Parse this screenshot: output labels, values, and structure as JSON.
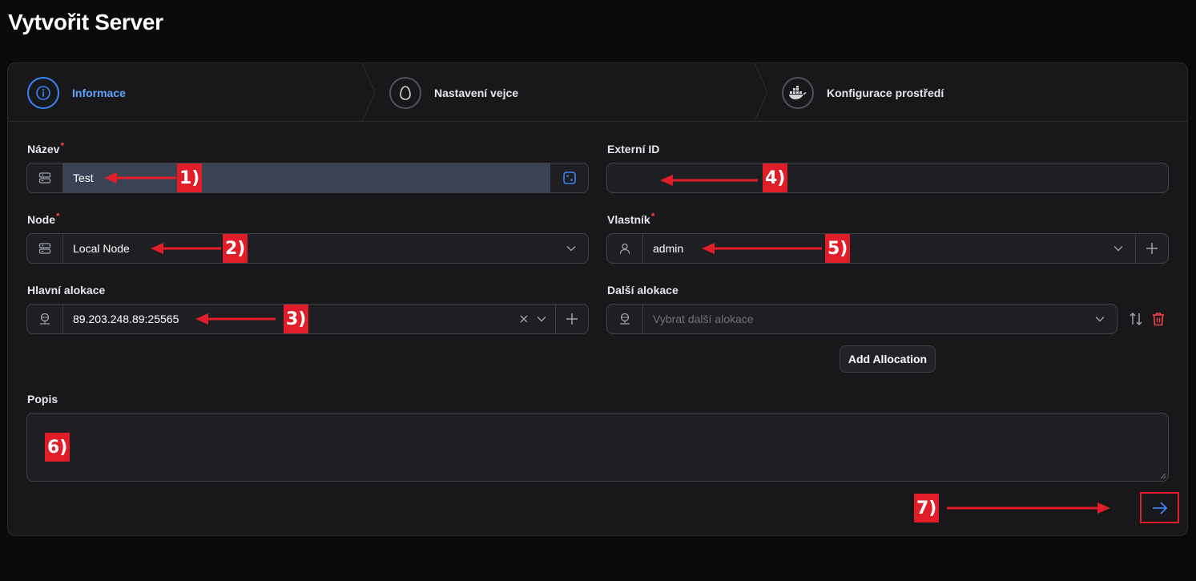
{
  "page": {
    "title": "Vytvořit Server"
  },
  "stepper": {
    "steps": [
      {
        "label": "Informace",
        "icon": "info-icon",
        "active": true
      },
      {
        "label": "Nastavení vejce",
        "icon": "egg-icon",
        "active": false
      },
      {
        "label": "Konfigurace prostředí",
        "icon": "docker-icon",
        "active": false
      }
    ]
  },
  "form": {
    "name": {
      "label": "Název",
      "required": "*",
      "value": "Test",
      "icon": "server-icon",
      "action_icon": "dice-icon"
    },
    "external_id": {
      "label": "Externí ID",
      "value": ""
    },
    "node": {
      "label": "Node",
      "required": "*",
      "value": "Local Node",
      "icon": "server-icon"
    },
    "owner": {
      "label": "Vlastník",
      "required": "*",
      "value": "admin",
      "icon": "user-icon"
    },
    "primary_allocation": {
      "label": "Hlavní alokace",
      "value": "89.203.248.89:25565",
      "icon": "network-icon"
    },
    "additional_allocations": {
      "label": "Další alokace",
      "placeholder": "Vybrat další alokace",
      "icon": "network-icon",
      "add_button": "Add Allocation"
    },
    "description": {
      "label": "Popis",
      "value": ""
    }
  },
  "annotations": {
    "b1": "1)",
    "b2": "2)",
    "b3": "3)",
    "b4": "4)",
    "b5": "5)",
    "b6": "6)",
    "b7": "7)"
  },
  "colors": {
    "accent": "#3b82f6",
    "annotation": "#e11d2a",
    "danger": "#ef4444",
    "background": "#0a0a0b",
    "card": "#18181b"
  }
}
